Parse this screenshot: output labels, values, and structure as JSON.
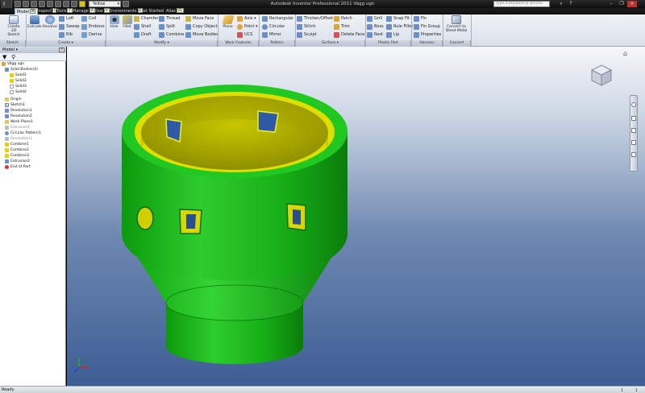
{
  "app": {
    "window_title": "Autodesk Inventor Professional 2011   Vägg ugn",
    "app_menu_label": "I",
    "material": "Yellow",
    "search_placeholder": "Type a keyword or phrase"
  },
  "tabs": [
    {
      "label": "Model",
      "keytip": "M"
    },
    {
      "label": "Inspect",
      "keytip": "I"
    },
    {
      "label": "Tools",
      "keytip": "T"
    },
    {
      "label": "Manage",
      "keytip": "A"
    },
    {
      "label": "View",
      "keytip": "V"
    },
    {
      "label": "Environments",
      "keytip": "E"
    },
    {
      "label": "Get Started",
      "keytip": ""
    },
    {
      "label": "Alias",
      "keytip": "AL"
    }
  ],
  "ribbon": {
    "sketch": {
      "create_2d_sketch": "Create 2D Sketch",
      "caption": "Sketch"
    },
    "create": {
      "extrude": "Extrude",
      "revolve": "Revolve",
      "loft": "Loft",
      "coil": "Coil",
      "sweep": "Sweep",
      "emboss": "Emboss",
      "rib": "Rib",
      "derive": "Derive",
      "caption": "Create ▾"
    },
    "modify": {
      "hole": "Hole",
      "fillet": "Fillet",
      "chamfer": "Chamfer",
      "thread": "Thread",
      "shell": "Shell",
      "split": "Split",
      "draft": "Draft",
      "combine": "Combine",
      "move_face": "Move Face",
      "copy_object": "Copy Object",
      "move_bodies": "Move Bodies",
      "caption": "Modify ▾"
    },
    "work_features": {
      "plane": "Plane",
      "axis": "Axis ▾",
      "point": "Point ▾",
      "ucs": "UCS",
      "caption": "Work Features"
    },
    "pattern": {
      "rectangular": "Rectangular",
      "circular": "Circular",
      "mirror": "Mirror",
      "caption": "Pattern"
    },
    "surface": {
      "thicken": "Thicken/Offset",
      "stitch": "Stitch",
      "sculpt": "Sculpt",
      "patch": "Patch",
      "trim": "Trim",
      "delete_face": "Delete Face",
      "caption": "Surface ▾"
    },
    "plastic_part": {
      "grill": "Grill",
      "snap_fit": "Snap Fit",
      "boss": "Boss",
      "rule_fillet": "Rule Fillet",
      "rest": "Rest",
      "lip": "Lip",
      "caption": "Plastic Part"
    },
    "harness": {
      "fin": "Fin",
      "fin_group": "Fin Group",
      "properties": "Properties",
      "caption": "Harness"
    },
    "convert": {
      "convert_sheet_metal": "Convert to Sheet Metal",
      "caption": "Convert"
    }
  },
  "browser": {
    "header": "Model ▾",
    "root": "Vägg ugn",
    "items": [
      {
        "label": "Solid Bodies(4)",
        "dim": false
      },
      {
        "label": "Solid1",
        "dim": false
      },
      {
        "label": "Solid2",
        "dim": false
      },
      {
        "label": "Solid3",
        "dim": false
      },
      {
        "label": "Solid4",
        "dim": false
      },
      {
        "label": "Origin",
        "dim": false
      },
      {
        "label": "Sketch1",
        "dim": false
      },
      {
        "label": "Revolution1",
        "dim": false
      },
      {
        "label": "Revolution2",
        "dim": false
      },
      {
        "label": "Work Plane1",
        "dim": false
      },
      {
        "label": "Extrusion1",
        "dim": true
      },
      {
        "label": "Circular Pattern1",
        "dim": false
      },
      {
        "label": "Revolution3",
        "dim": true
      },
      {
        "label": "Combine1",
        "dim": false
      },
      {
        "label": "Combine2",
        "dim": false
      },
      {
        "label": "Combine3",
        "dim": false
      },
      {
        "label": "Extrusion2",
        "dim": false
      },
      {
        "label": "End of Part",
        "dim": false
      }
    ]
  },
  "status": {
    "text": "Ready",
    "num1": "1",
    "num2": "1"
  },
  "colors": {
    "part_green": "#1fc21f",
    "part_yellow": "#d8d800",
    "viewport_bottom": "#3d5d94",
    "ribbon_bg": "#e6ebf1"
  }
}
